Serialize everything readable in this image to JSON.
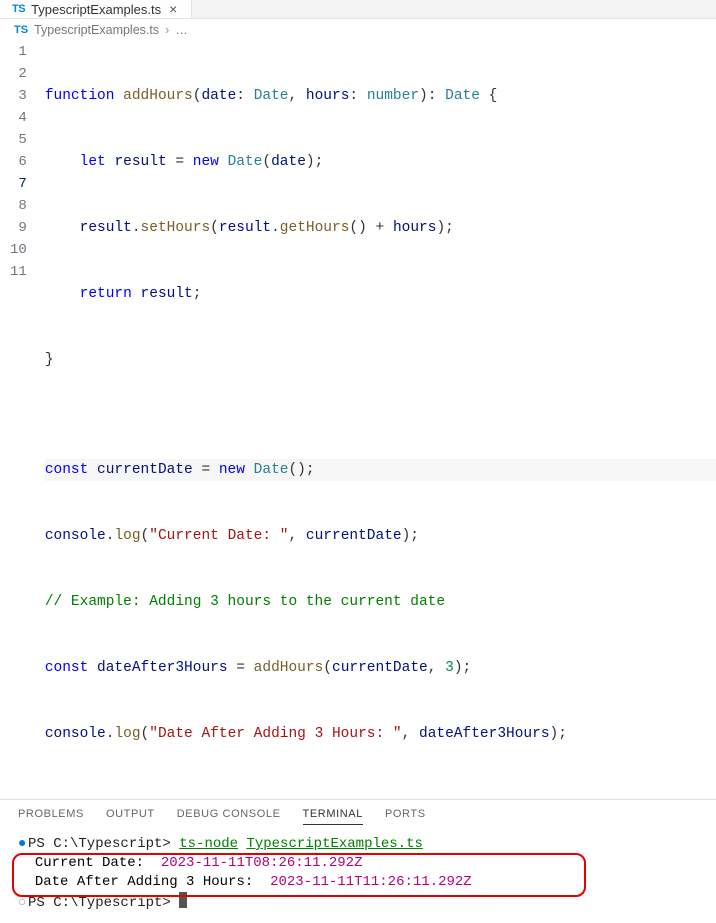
{
  "tab": {
    "icon_label": "TS",
    "filename": "TypescriptExamples.ts",
    "close_glyph": "×"
  },
  "breadcrumb": {
    "icon_label": "TS",
    "file": "TypescriptExamples.ts",
    "chevron": "›",
    "ellipsis": "…"
  },
  "editor": {
    "line_numbers": [
      "1",
      "2",
      "3",
      "4",
      "5",
      "6",
      "7",
      "8",
      "9",
      "10",
      "11"
    ],
    "active_line_index": 6,
    "lines": {
      "l1": {
        "kw1": "function",
        "fn": "addHours",
        "p_open": "(",
        "p1": "date",
        "colon1": ": ",
        "t1": "Date",
        "comma": ", ",
        "p2": "hours",
        "colon2": ": ",
        "t2": "number",
        "p_close": ")",
        "colon3": ": ",
        "t3": "Date",
        "brace": " {"
      },
      "l2": {
        "indent": "    ",
        "kw": "let",
        "sp": " ",
        "var": "result",
        "eq": " = ",
        "new": "new",
        "sp2": " ",
        "type": "Date",
        "args": "(",
        "arg": "date",
        "close": ");"
      },
      "l3": {
        "indent": "    ",
        "var": "result",
        "dot": ".",
        "fn": "setHours",
        "open": "(",
        "var2": "result",
        "dot2": ".",
        "fn2": "getHours",
        "empty": "()",
        "plus": " + ",
        "var3": "hours",
        "close": ");"
      },
      "l4": {
        "indent": "    ",
        "kw": "return",
        "sp": " ",
        "var": "result",
        "semi": ";"
      },
      "l5": {
        "brace": "}"
      },
      "l6": {
        "blank": ""
      },
      "l7": {
        "kw": "const",
        "sp": " ",
        "var": "currentDate",
        "eq": " = ",
        "new": "new",
        "sp2": " ",
        "type": "Date",
        "call": "();"
      },
      "l8": {
        "obj": "console",
        "dot": ".",
        "fn": "log",
        "open": "(",
        "str": "\"Current Date: \"",
        "comma": ", ",
        "var": "currentDate",
        "close": ");"
      },
      "l9": {
        "cmt": "// Example: Adding 3 hours to the current date"
      },
      "l10": {
        "kw": "const",
        "sp": " ",
        "var": "dateAfter3Hours",
        "eq": " = ",
        "fn": "addHours",
        "open": "(",
        "a1": "currentDate",
        "comma": ", ",
        "num": "3",
        "close": ");"
      },
      "l11": {
        "obj": "console",
        "dot": ".",
        "fn": "log",
        "open": "(",
        "str": "\"Date After Adding 3 Hours: \"",
        "comma": ", ",
        "var": "dateAfter3Hours",
        "close": ");"
      }
    }
  },
  "panel": {
    "tabs": {
      "problems": "PROBLEMS",
      "output": "OUTPUT",
      "debug": "DEBUG CONSOLE",
      "terminal": "TERMINAL",
      "ports": "PORTS"
    }
  },
  "terminal": {
    "bullet_filled": "●",
    "bullet_hollow": "○",
    "prompt1_path": "PS C:\\Typescript> ",
    "cmd_tool": "ts-node",
    "cmd_sp": " ",
    "cmd_arg": "TypescriptExamples.ts",
    "out1_label": "Current Date:  ",
    "out1_value": "2023-11-11T08:26:11.292Z",
    "out2_label": "Date After Adding 3 Hours:  ",
    "out2_value": "2023-11-11T11:26:11.292Z",
    "prompt2_path": "PS C:\\Typescript> "
  }
}
